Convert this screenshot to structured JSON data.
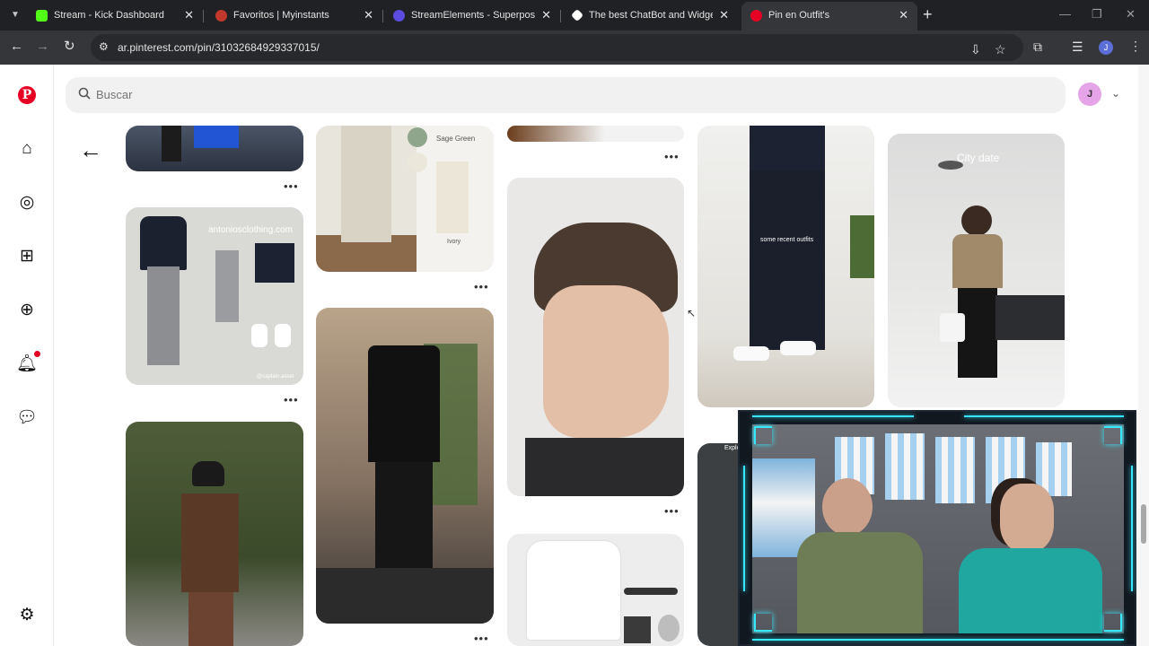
{
  "browser": {
    "tabs": [
      {
        "title": "Stream - Kick Dashboard",
        "favicon_color": "#53fc18",
        "active": false
      },
      {
        "title": "Favoritos | Myinstants",
        "favicon_color": "#c0392b",
        "active": false
      },
      {
        "title": "StreamElements - Superposicion",
        "favicon_color": "#5c4ce0",
        "active": false
      },
      {
        "title": "The best ChatBot and Widgets",
        "favicon_color": "#ffffff",
        "active": false
      },
      {
        "title": "Pin en Outfit's",
        "favicon_color": "#e60023",
        "active": true
      }
    ],
    "url": "ar.pinterest.com/pin/310326849293370​15/",
    "profile_initial": "J"
  },
  "pinterest": {
    "search_placeholder": "Buscar",
    "user_initial": "J",
    "pins": {
      "a2_text": "antoniosclothing.com",
      "a2_sub": "@captain.asset",
      "b1_label1": "Sage Green",
      "b1_label2": "Ivory",
      "d1_text": "some recent outfits",
      "e1_text": "City date",
      "d2_text": "Explorando"
    },
    "more_label": "•••"
  },
  "colors": {
    "brand": "#e60023",
    "neon": "#35e8ff",
    "chrome_dark": "#202124"
  }
}
